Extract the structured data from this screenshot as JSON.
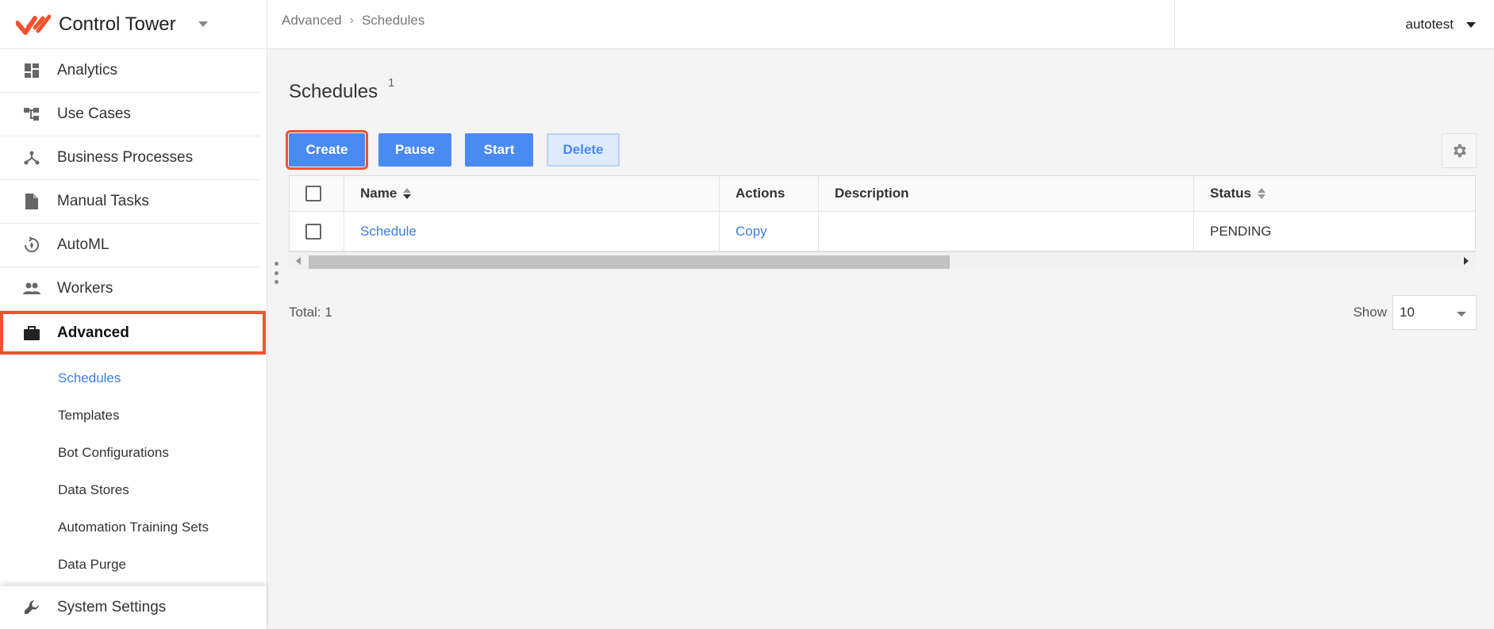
{
  "app": {
    "title": "Control Tower",
    "accent_color": "#f0522f",
    "primary_color": "#4a8af4"
  },
  "sidebar": {
    "items": [
      {
        "label": "Analytics",
        "icon": "dashboard-icon"
      },
      {
        "label": "Use Cases",
        "icon": "hierarchy-icon"
      },
      {
        "label": "Business Processes",
        "icon": "process-branch-icon"
      },
      {
        "label": "Manual Tasks",
        "icon": "document-icon"
      },
      {
        "label": "AutoML",
        "icon": "automl-icon"
      },
      {
        "label": "Workers",
        "icon": "people-icon"
      },
      {
        "label": "Advanced",
        "icon": "briefcase-icon",
        "active": true
      }
    ],
    "subitems": [
      {
        "label": "Schedules",
        "current": true
      },
      {
        "label": "Templates"
      },
      {
        "label": "Bot Configurations"
      },
      {
        "label": "Data Stores"
      },
      {
        "label": "Automation Training Sets"
      },
      {
        "label": "Data Purge"
      }
    ],
    "system_settings": {
      "label": "System Settings",
      "icon": "wrench-icon"
    }
  },
  "header": {
    "breadcrumb": [
      "Advanced",
      "Schedules"
    ],
    "user": "autotest"
  },
  "main": {
    "title": "Schedules",
    "count": "1",
    "buttons": {
      "create": "Create",
      "pause": "Pause",
      "start": "Start",
      "delete": "Delete"
    },
    "table": {
      "columns": [
        "Name",
        "Actions",
        "Description",
        "Status"
      ],
      "rows": [
        {
          "name": "Schedule",
          "action": "Copy",
          "description": "",
          "status": "PENDING"
        }
      ]
    },
    "total": "Total: 1",
    "show_label": "Show",
    "page_size": "10"
  }
}
